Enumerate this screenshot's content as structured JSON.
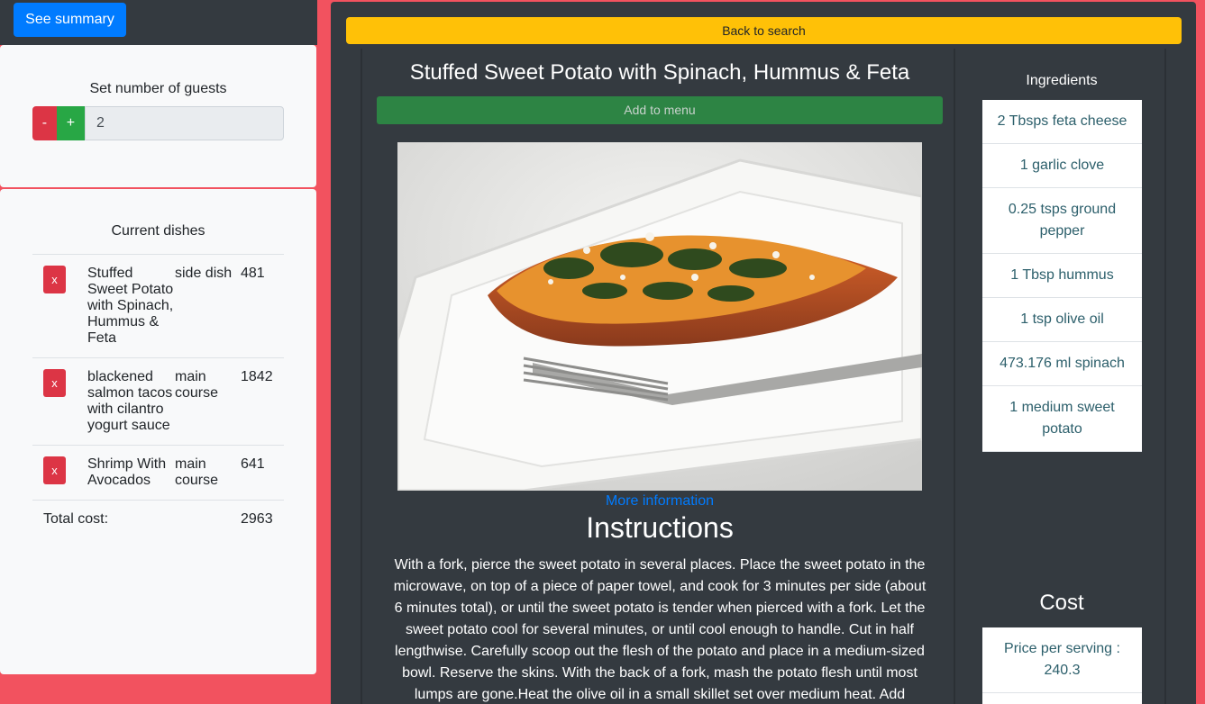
{
  "header": {
    "summary_label": "See summary"
  },
  "guests": {
    "title": "Set number of guests",
    "minus_label": "-",
    "plus_label": "+",
    "value": "2"
  },
  "menu": {
    "title": "Current dishes",
    "dishes": [
      {
        "remove_label": "x",
        "name": "Stuffed Sweet Potato with Spinach, Hummus & Feta",
        "type": "side dish",
        "cost": "481"
      },
      {
        "remove_label": "x",
        "name": "blackened salmon tacos with cilantro yogurt sauce",
        "type": "main course",
        "cost": "1842"
      },
      {
        "remove_label": "x",
        "name": "Shrimp With Avocados",
        "type": "main course",
        "cost": "641"
      }
    ],
    "total_label": "Total cost:",
    "total_value": "2963"
  },
  "details": {
    "back_label": "Back to search",
    "title": "Stuffed Sweet Potato with Spinach, Hummus & Feta",
    "add_label": "Add to menu",
    "more_link": "More information",
    "instructions_title": "Instructions",
    "instructions_text": "With a fork, pierce the sweet potato in several places. Place the sweet potato in the microwave, on top of a piece of paper towel, and cook for 3 minutes per side (about 6 minutes total), or until the sweet potato is tender when pierced with a fork. Let the sweet potato cool for several minutes, or until cool enough to handle. Cut in half lengthwise. Carefully scoop out the flesh of the potato and place in a medium-sized bowl. Reserve the skins. With the back of a fork, mash the potato flesh until most lumps are gone.Heat the olive oil in a small skillet set over medium heat. Add"
  },
  "ingredients": {
    "title": "Ingredients",
    "items": [
      "2 Tbsps feta cheese",
      "1 garlic clove",
      "0.25 tsps ground pepper",
      "1 Tbsp hummus",
      "1 tsp olive oil",
      "473.176 ml spinach",
      "1 medium sweet potato"
    ]
  },
  "cost": {
    "title": "Cost",
    "price_label": "Price per serving : 240.3"
  },
  "colors": {
    "page_bg": "#f2525f",
    "panel_dark": "#343a40",
    "primary": "#007bff",
    "warning": "#ffc107",
    "success": "#2d8444",
    "danger": "#dc3545"
  }
}
